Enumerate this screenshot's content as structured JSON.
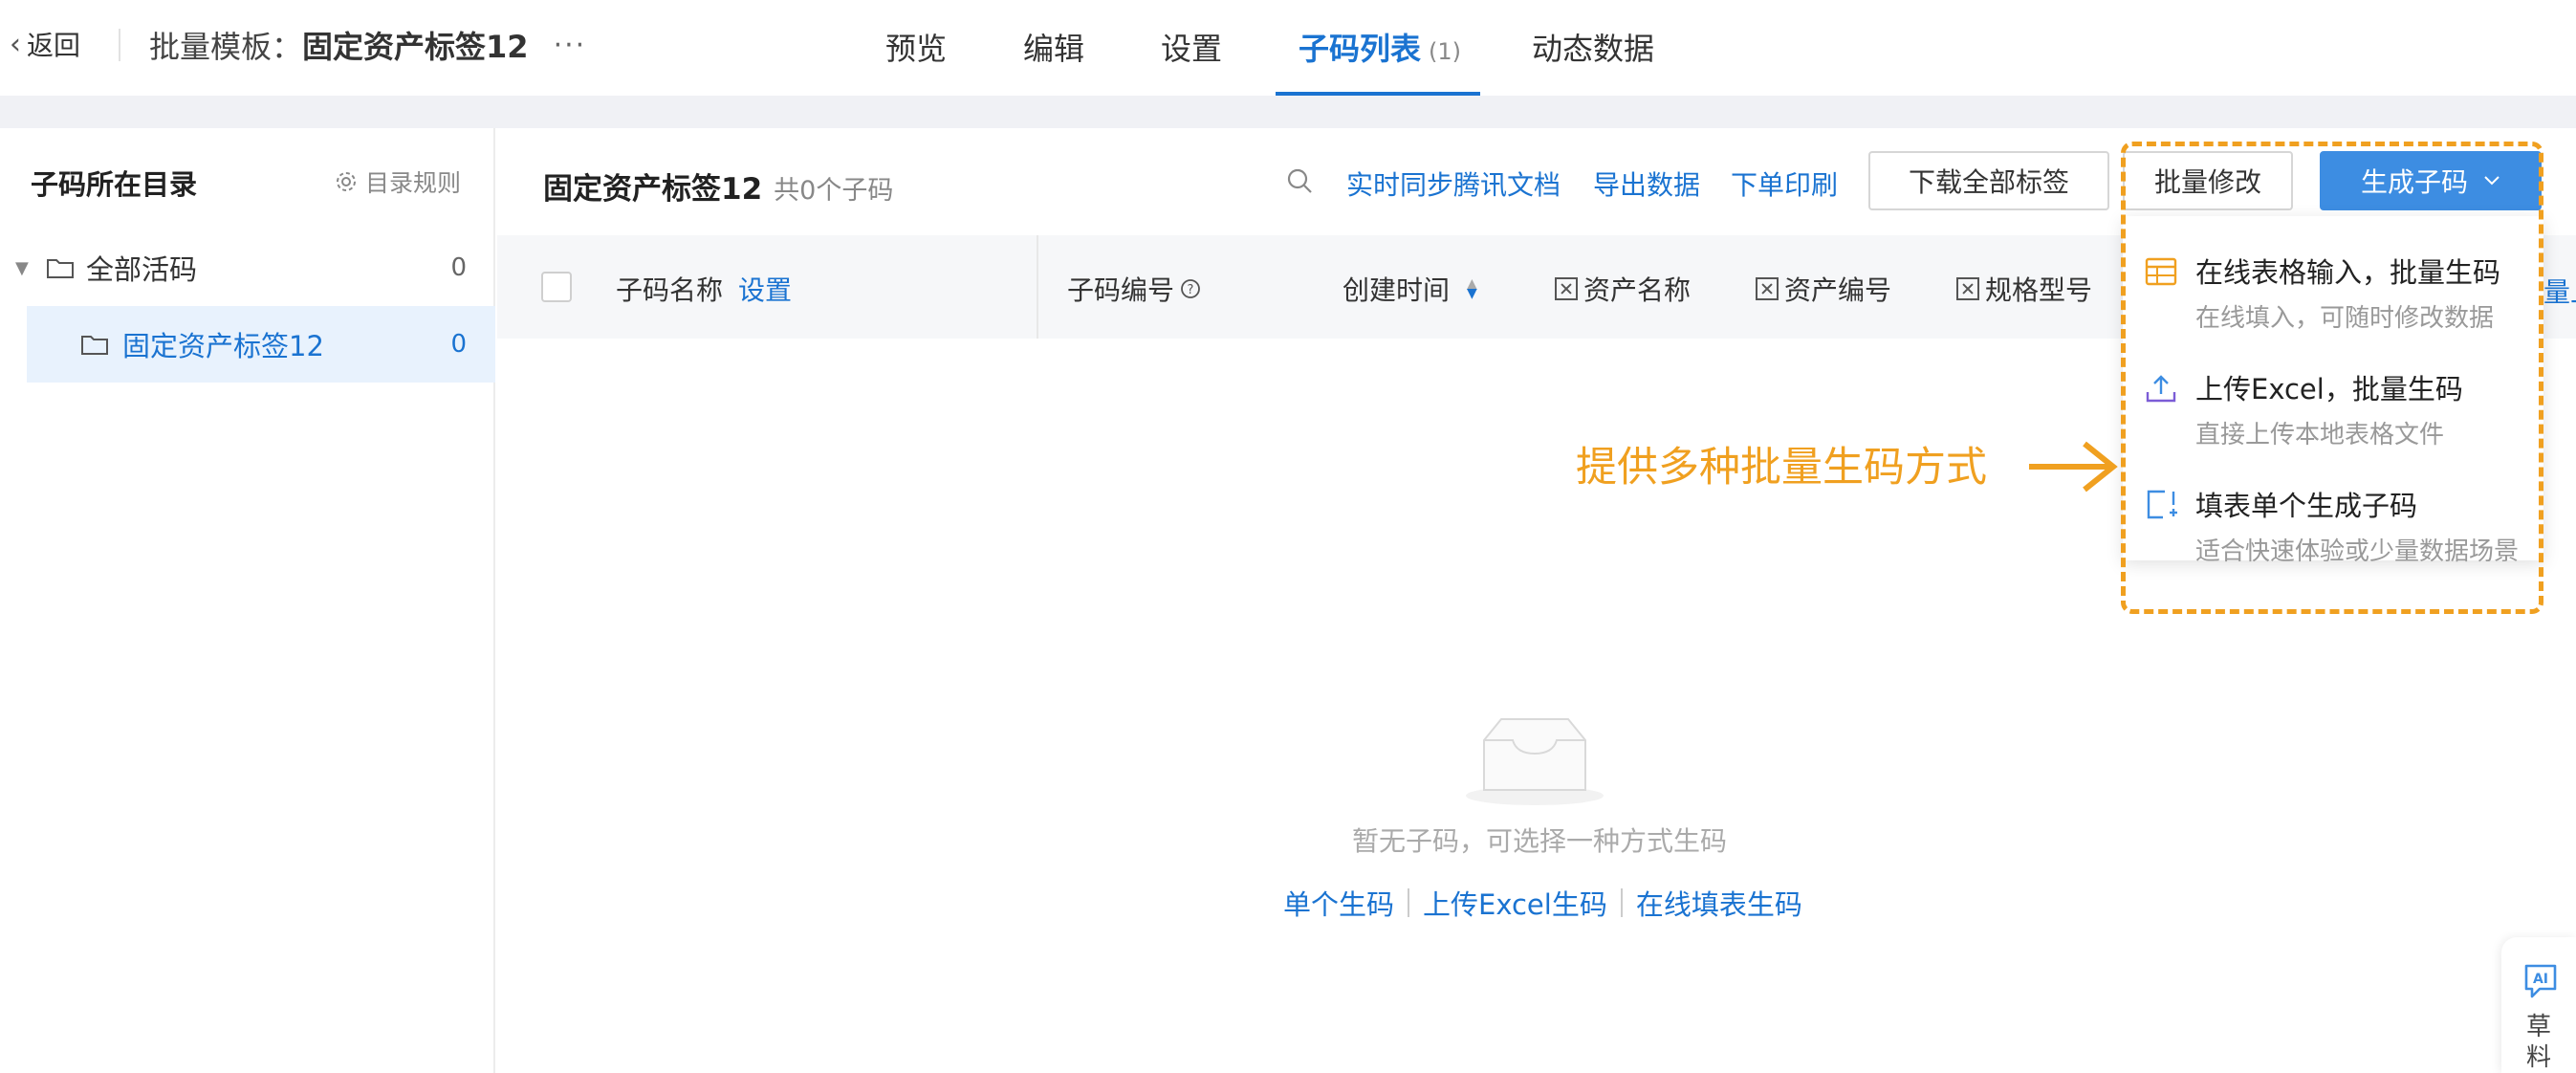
{
  "topbar": {
    "back_label": "返回",
    "crumb_prefix": "批量模板：",
    "crumb_name": "固定资产标签12",
    "more": "···",
    "tabs": [
      {
        "label": "预览"
      },
      {
        "label": "编辑"
      },
      {
        "label": "设置"
      },
      {
        "label": "子码列表",
        "count": "(1)",
        "active": true
      },
      {
        "label": "动态数据"
      }
    ]
  },
  "sidebar": {
    "title": "子码所在目录",
    "rules_label": "目录规则",
    "items": [
      {
        "label": "全部活码",
        "count": "0"
      },
      {
        "label": "固定资产标签12",
        "count": "0",
        "selected": true
      }
    ]
  },
  "main": {
    "title": "固定资产标签12",
    "total": "共0个子码",
    "links": {
      "sync": "实时同步腾讯文档",
      "export": "导出数据",
      "order_print": "下单印刷"
    },
    "download_all": "下载全部标签",
    "batch_edit": "批量修改",
    "generate": "生成子码",
    "columns": {
      "name": "子码名称",
      "name_setting": "设置",
      "code": "子码编号",
      "created": "创建时间",
      "asset_name": "资产名称",
      "asset_code": "资产编号",
      "spec_model": "规格型号"
    },
    "edge_link": "量上"
  },
  "empty": {
    "text": "暂无子码，可选择一种方式生码",
    "links": [
      "单个生码",
      "上传Excel生码",
      "在线填表生码"
    ]
  },
  "dropdown": {
    "items": [
      {
        "title": "在线表格输入，批量生码",
        "desc": "在线填入，可随时修改数据",
        "icon": "table-icon"
      },
      {
        "title": "上传Excel，批量生码",
        "desc": "直接上传本地表格文件",
        "icon": "upload-icon"
      },
      {
        "title": "填表单个生成子码",
        "desc": "适合快速体验或少量数据场景",
        "icon": "form-add-icon"
      }
    ]
  },
  "annotation": {
    "text": "提供多种批量生码方式"
  },
  "ai_widget": {
    "label": "草料"
  },
  "colors": {
    "accent": "#1a73d1",
    "primary_button": "#3d8de2",
    "annotation": "#f0a020",
    "selected_bg": "#e8f2fd"
  }
}
